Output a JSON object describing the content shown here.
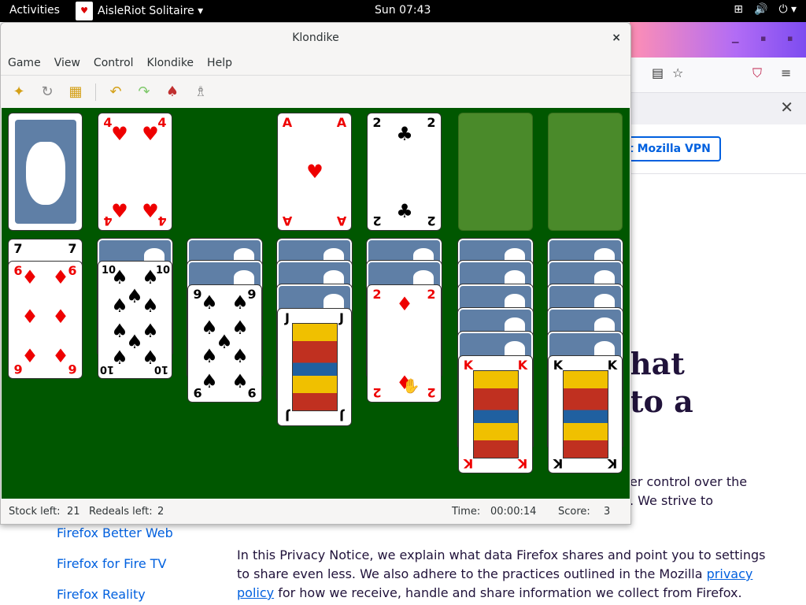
{
  "topbar": {
    "activities": "Activities",
    "app_name": "AisleRiot Solitaire ▾",
    "clock": "Sun 07:43",
    "tray": [
      "⊞",
      "🔊",
      "⏻ ▾"
    ]
  },
  "window": {
    "title": "Klondike",
    "close": "×",
    "menu": [
      "Game",
      "View",
      "Control",
      "Klondike",
      "Help"
    ]
  },
  "toolbar": {
    "buttons": [
      "new-game",
      "restart",
      "select-game",
      "undo",
      "redo",
      "deal",
      "hint"
    ]
  },
  "status": {
    "stock_left_label": "Stock left:",
    "stock_left": "21",
    "redeals_left_label": "Redeals left:",
    "redeals_left": "2",
    "time_label": "Time:",
    "time": "00:00:14",
    "score_label": "Score:",
    "score": "3"
  },
  "cards": {
    "waste": {
      "rank": "4",
      "suit": "♥"
    },
    "foundation1": {
      "rank": "A",
      "suit": "♥"
    },
    "foundation2": {
      "rank": "2",
      "suit": "♣"
    },
    "t1_hidden": {
      "rank": "7",
      "suit": "♣"
    },
    "t1": {
      "rank": "6",
      "suit": "♦"
    },
    "t2": {
      "rank": "10",
      "suit": "♠"
    },
    "t3": {
      "rank": "9",
      "suit": "♠"
    },
    "t4": {
      "rank": "J",
      "suit": "♠"
    },
    "t5": {
      "rank": "2",
      "suit": "♦"
    },
    "t6": {
      "rank": "K",
      "suit": "♦"
    },
    "t7": {
      "rank": "K",
      "suit": "♣"
    }
  },
  "firefox": {
    "vpn_button": "t Mozilla VPN",
    "heading_line1": "hat",
    "heading_line2": "to a",
    "para_line1": "er control over the",
    "para_line2": ". We strive to",
    "side_links": [
      "Firefox Better Web",
      "Firefox for Fire TV",
      "Firefox Reality"
    ],
    "privacy_text_a": "In this Privacy Notice, we explain what data Firefox shares and point you to settings to share even less. We also adhere to the practices outlined in the Mozilla ",
    "privacy_link1": "privacy policy",
    "privacy_text_b": " for how we receive, handle and share information we collect from Firefox."
  }
}
